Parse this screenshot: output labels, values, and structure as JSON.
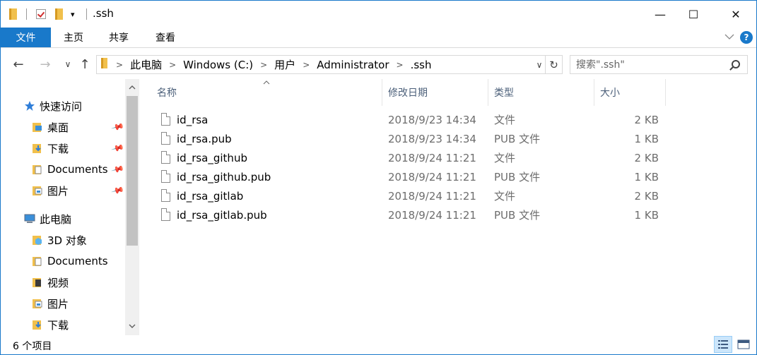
{
  "window": {
    "title": ".ssh",
    "minimize": "—",
    "maximize": "☐",
    "close": "✕"
  },
  "ribbon": {
    "tabs": [
      "文件",
      "主页",
      "共享",
      "查看"
    ]
  },
  "nav": {
    "back": "←",
    "forward": "→",
    "recent": "∨",
    "up": "↑",
    "breadcrumb": [
      "此电脑",
      "Windows (C:)",
      "用户",
      "Administrator",
      ".ssh"
    ],
    "search_placeholder": "搜索\".ssh\""
  },
  "sidebar": {
    "quick_access": "快速访问",
    "pinned": [
      "桌面",
      "下载",
      "Documents",
      "图片"
    ],
    "this_pc": "此电脑",
    "pc_items": [
      "3D 对象",
      "Documents",
      "视频",
      "图片",
      "下载"
    ]
  },
  "columns": {
    "name": "名称",
    "date": "修改日期",
    "type": "类型",
    "size": "大小"
  },
  "files": [
    {
      "name": "id_rsa",
      "date": "2018/9/23 14:34",
      "type": "文件",
      "size": "2 KB"
    },
    {
      "name": "id_rsa.pub",
      "date": "2018/9/23 14:34",
      "type": "PUB 文件",
      "size": "1 KB"
    },
    {
      "name": "id_rsa_github",
      "date": "2018/9/24 11:21",
      "type": "文件",
      "size": "2 KB"
    },
    {
      "name": "id_rsa_github.pub",
      "date": "2018/9/24 11:21",
      "type": "PUB 文件",
      "size": "1 KB"
    },
    {
      "name": "id_rsa_gitlab",
      "date": "2018/9/24 11:21",
      "type": "文件",
      "size": "2 KB"
    },
    {
      "name": "id_rsa_gitlab.pub",
      "date": "2018/9/24 11:21",
      "type": "PUB 文件",
      "size": "1 KB"
    }
  ],
  "status": {
    "item_count": "6 个项目"
  },
  "colors": {
    "accent": "#1979ca",
    "folder": "#e8b13b",
    "header_text": "#4c607a"
  }
}
